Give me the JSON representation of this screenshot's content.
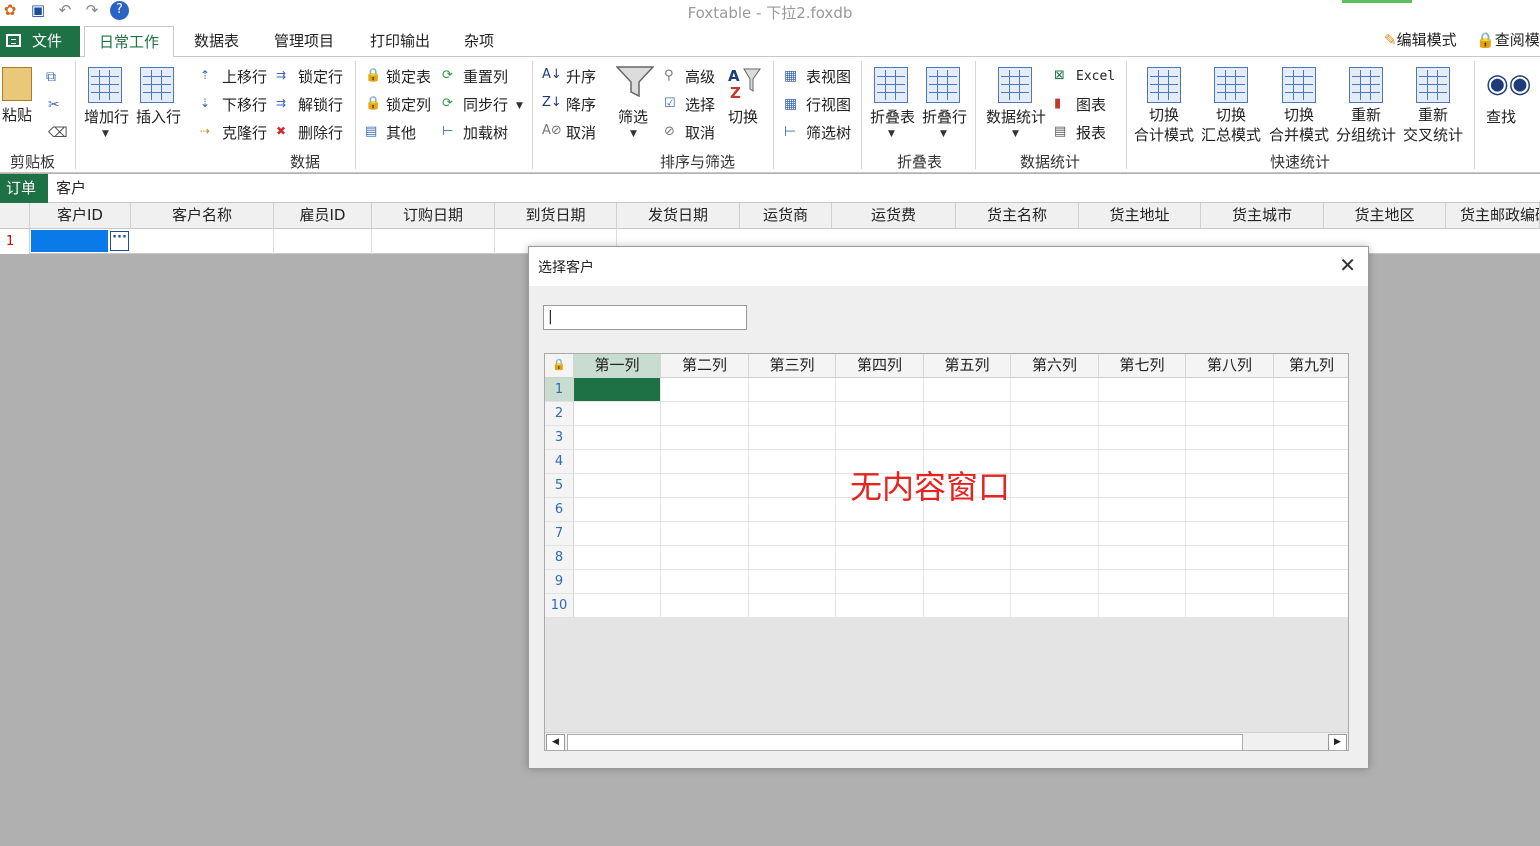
{
  "window": {
    "title": "Foxtable - 下拉2.foxdb"
  },
  "tabs": {
    "file": "文件",
    "items": [
      "日常工作",
      "数据表",
      "管理项目",
      "打印输出",
      "杂项"
    ],
    "edit_mode": "编辑模式",
    "query_mode": "查阅模"
  },
  "ribbon": {
    "clipboard": {
      "paste": "粘贴",
      "label": "剪贴板"
    },
    "data": {
      "add_row": "增加行",
      "insert_row": "插入行",
      "move_up": "上移行",
      "move_down": "下移行",
      "clone_row": "克隆行",
      "lock_row": "锁定行",
      "unlock_row": "解锁行",
      "delete_row": "删除行",
      "lock_table": "锁定表",
      "lock_col": "锁定列",
      "other": "其他",
      "reset_row": "重置列",
      "sync_row": "同步行",
      "load_tree": "加载树",
      "label": "数据"
    },
    "sort": {
      "asc": "升序",
      "desc": "降序",
      "cancel": "取消",
      "filter": "筛选",
      "advanced": "高级",
      "select": "选择",
      "cancel2": "取消",
      "switch": "切换",
      "label": "排序与筛选"
    },
    "views": {
      "table_view": "表视图",
      "row_view": "行视图",
      "filter_tree": "筛选树"
    },
    "fold": {
      "fold_table": "折叠表",
      "fold_row": "折叠行",
      "label": "折叠表"
    },
    "stats": {
      "data_stats": "数据统计",
      "excel": "Excel",
      "chart": "图表",
      "report": "报表",
      "label": "数据统计"
    },
    "quick": {
      "items": [
        {
          "l1": "切换",
          "l2": "合计模式"
        },
        {
          "l1": "切换",
          "l2": "汇总模式"
        },
        {
          "l1": "切换",
          "l2": "合并模式"
        },
        {
          "l1": "重新",
          "l2": "分组统计"
        },
        {
          "l1": "重新",
          "l2": "交叉统计"
        }
      ],
      "label": "快速统计"
    },
    "find": "查找"
  },
  "sheets": [
    "订单",
    "客户"
  ],
  "main_grid": {
    "columns": [
      "客户ID",
      "客户名称",
      "雇员ID",
      "订购日期",
      "到货日期",
      "发货日期",
      "运货商",
      "运货费",
      "货主名称",
      "货主地址",
      "货主城市",
      "货主地区",
      "货主邮政编码"
    ],
    "row_number": "1"
  },
  "dialog": {
    "title": "选择客户",
    "close": "✕",
    "input_value": "",
    "columns": [
      "第一列",
      "第二列",
      "第三列",
      "第四列",
      "第五列",
      "第六列",
      "第七列",
      "第八列",
      "第九列"
    ],
    "rows": [
      "1",
      "2",
      "3",
      "4",
      "5",
      "6",
      "7",
      "8",
      "9",
      "10"
    ],
    "overlay": "无内容窗口"
  }
}
